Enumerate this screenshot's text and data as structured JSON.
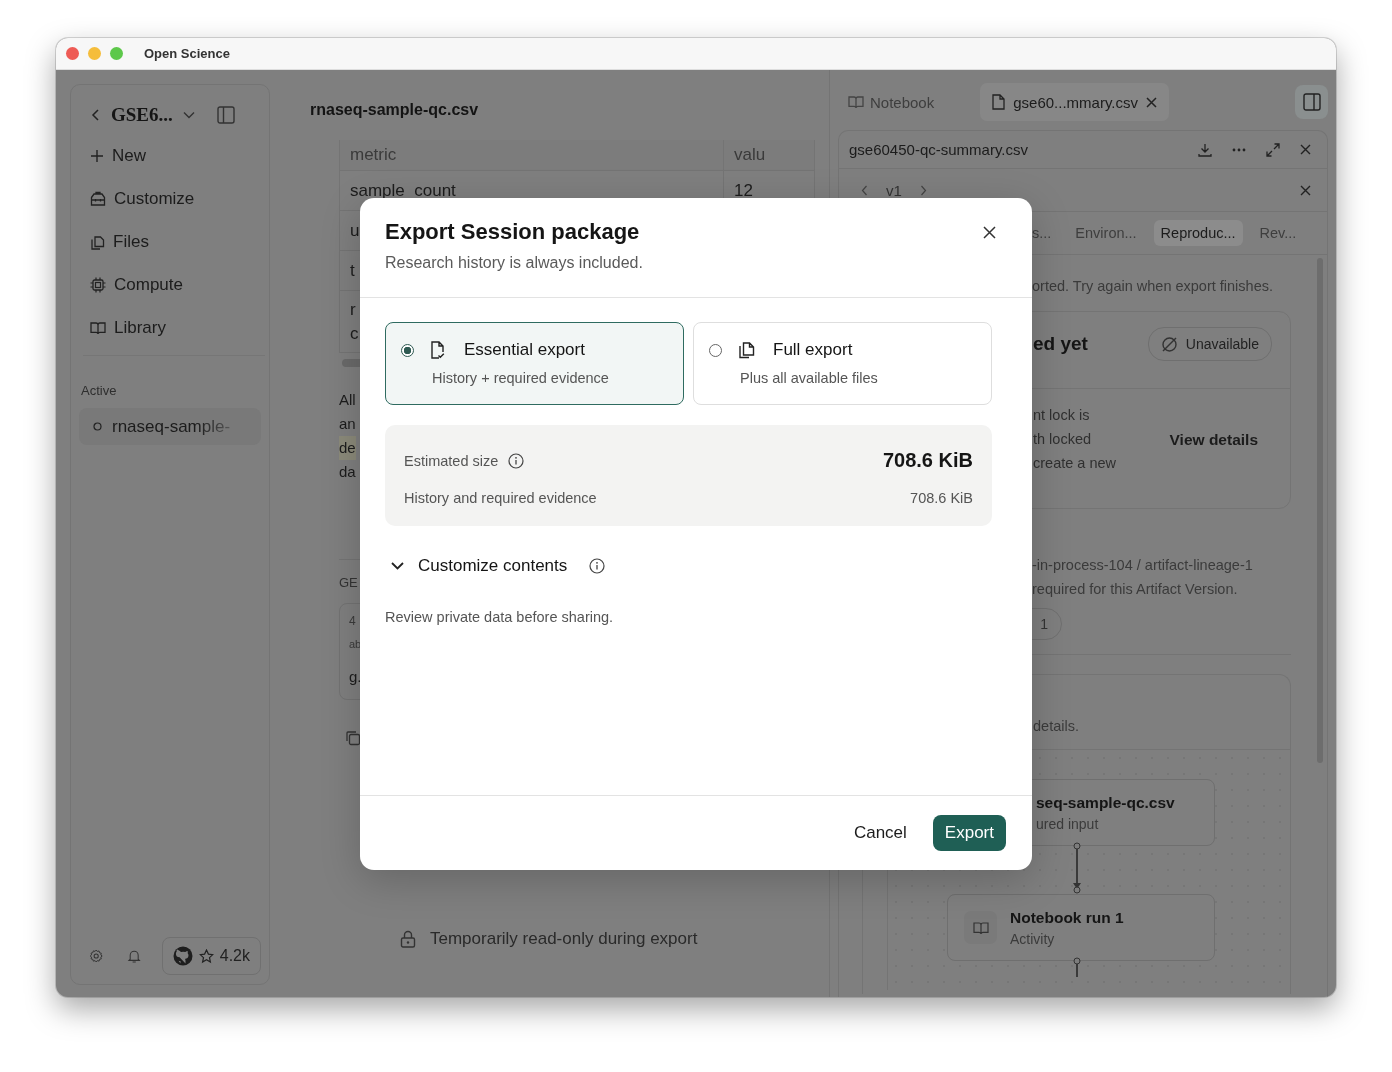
{
  "window": {
    "title": "Open Science"
  },
  "sidebar": {
    "project": "GSE6...",
    "nav": [
      {
        "label": "New",
        "kind": "plus"
      },
      {
        "label": "Customize",
        "kind": "toolbox"
      },
      {
        "label": "Files",
        "kind": "files"
      },
      {
        "label": "Compute",
        "kind": "chip"
      },
      {
        "label": "Library",
        "kind": "book"
      }
    ],
    "section_label": "Active",
    "active_items": [
      {
        "label": "rnaseq-sample-"
      }
    ],
    "github_stars": "4.2k"
  },
  "main": {
    "title": "rnaseq-sample-qc.csv",
    "table": {
      "columns": [
        "metric",
        "valu"
      ],
      "rows": [
        [
          "sample_count",
          "12"
        ],
        [
          "u"
        ],
        [
          "t"
        ],
        [
          "r\nc"
        ]
      ]
    },
    "paragraph_lines": [
      {
        "text": "All",
        "highlighted": false
      },
      {
        "text": "an",
        "highlighted": false
      },
      {
        "text": "de",
        "highlighted": true
      },
      {
        "text": "da",
        "highlighted": false
      }
    ],
    "section_label": "GE",
    "card_lines": [
      "4",
      "ab",
      "g."
    ],
    "status": "Temporarily read-only during export"
  },
  "right_panel": {
    "tabs": [
      {
        "label": "Notebook",
        "kind": "notebook",
        "selected": false
      },
      {
        "label": "gse60...mmary.csv",
        "kind": "file",
        "selected": true
      }
    ],
    "file": {
      "name": "gse60450-qc-summary.csv",
      "version": "v1",
      "subtabs": [
        {
          "label": "s...",
          "selected": false
        },
        {
          "label": "Environ...",
          "selected": false
        },
        {
          "label": "Reproduc...",
          "selected": true
        },
        {
          "label": "Rev...",
          "selected": false
        }
      ],
      "notice": "orted. Try again when export finishes.",
      "status_card": {
        "title": "ed yet",
        "badge": "Unavailable",
        "lines": [
          "nt lock is",
          "th locked",
          "create a new"
        ],
        "action": "View details"
      },
      "lineage_lines": [
        "-in-process-104 / artifact-lineage-1",
        "required for this Artifact Version."
      ],
      "pill": "1",
      "graph_card": {
        "caption": "details.",
        "nodes": [
          {
            "title": "seq-sample-qc.csv",
            "subtitle": "ured input",
            "kind": "file"
          },
          {
            "title": "Notebook run 1",
            "subtitle": "Activity",
            "kind": "activity"
          }
        ]
      }
    }
  },
  "dialog": {
    "title": "Export Session package",
    "subtitle": "Research history is always included.",
    "options": [
      {
        "title": "Essential export",
        "description": "History + required evidence",
        "kind": "essential",
        "selected": true
      },
      {
        "title": "Full export",
        "description": "Plus all available files",
        "kind": "full",
        "selected": false
      }
    ],
    "size": {
      "label": "Estimated size",
      "total": "708.6 KiB",
      "breakdown": [
        {
          "label": "History and required evidence",
          "value": "708.6 KiB"
        }
      ]
    },
    "customize": {
      "label": "Customize contents",
      "expanded": true
    },
    "note": "Review private data before sharing.",
    "buttons": [
      {
        "label": "Cancel",
        "kind": "secondary"
      },
      {
        "label": "Export",
        "kind": "primary"
      }
    ]
  }
}
